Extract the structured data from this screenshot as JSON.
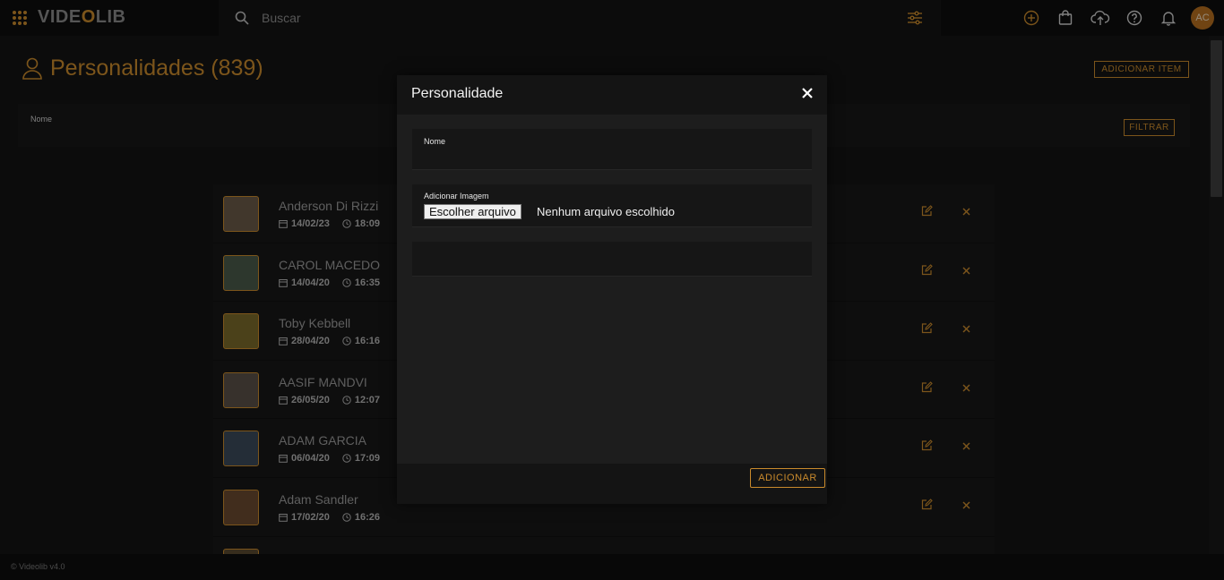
{
  "topbar": {
    "logo_left": "VIDE",
    "logo_o": "O",
    "logo_right": "LIB",
    "search_placeholder": "Buscar",
    "avatar_initials": "AC",
    "icons": [
      "apps-grid-icon",
      "search-icon",
      "filter-sliders-icon",
      "add-circle-icon",
      "shopping-bag-icon",
      "cloud-upload-icon",
      "help-icon",
      "bell-icon"
    ]
  },
  "page": {
    "title": "Personalidades (839)",
    "add_item_label": "ADICIONAR ITEM",
    "filter_label": "Nome",
    "filter_button": "FILTRAR"
  },
  "people": [
    {
      "name": "Anderson Di Rizzi",
      "date": "14/02/23",
      "time": "18:09"
    },
    {
      "name": "CAROL MACEDO",
      "date": "14/04/20",
      "time": "16:35"
    },
    {
      "name": "Toby Kebbell",
      "date": "28/04/20",
      "time": "16:16"
    },
    {
      "name": "AASIF MANDVI",
      "date": "26/05/20",
      "time": "12:07"
    },
    {
      "name": "ADAM GARCIA",
      "date": "06/04/20",
      "time": "17:09"
    },
    {
      "name": "Adam Sandler",
      "date": "17/02/20",
      "time": "16:26"
    }
  ],
  "footer": {
    "version": "© Videolib v4.0"
  },
  "modal": {
    "title": "Personalidade",
    "name_label": "Nome",
    "image_label": "Adicionar Imagem",
    "file_button": "Escolher arquivo",
    "file_status": "Nenhum arquivo escolhido",
    "submit_label": "ADICIONAR"
  },
  "colors": {
    "accent": "#c98a2c",
    "background": "#141414",
    "topbar": "#0d0d0d"
  }
}
